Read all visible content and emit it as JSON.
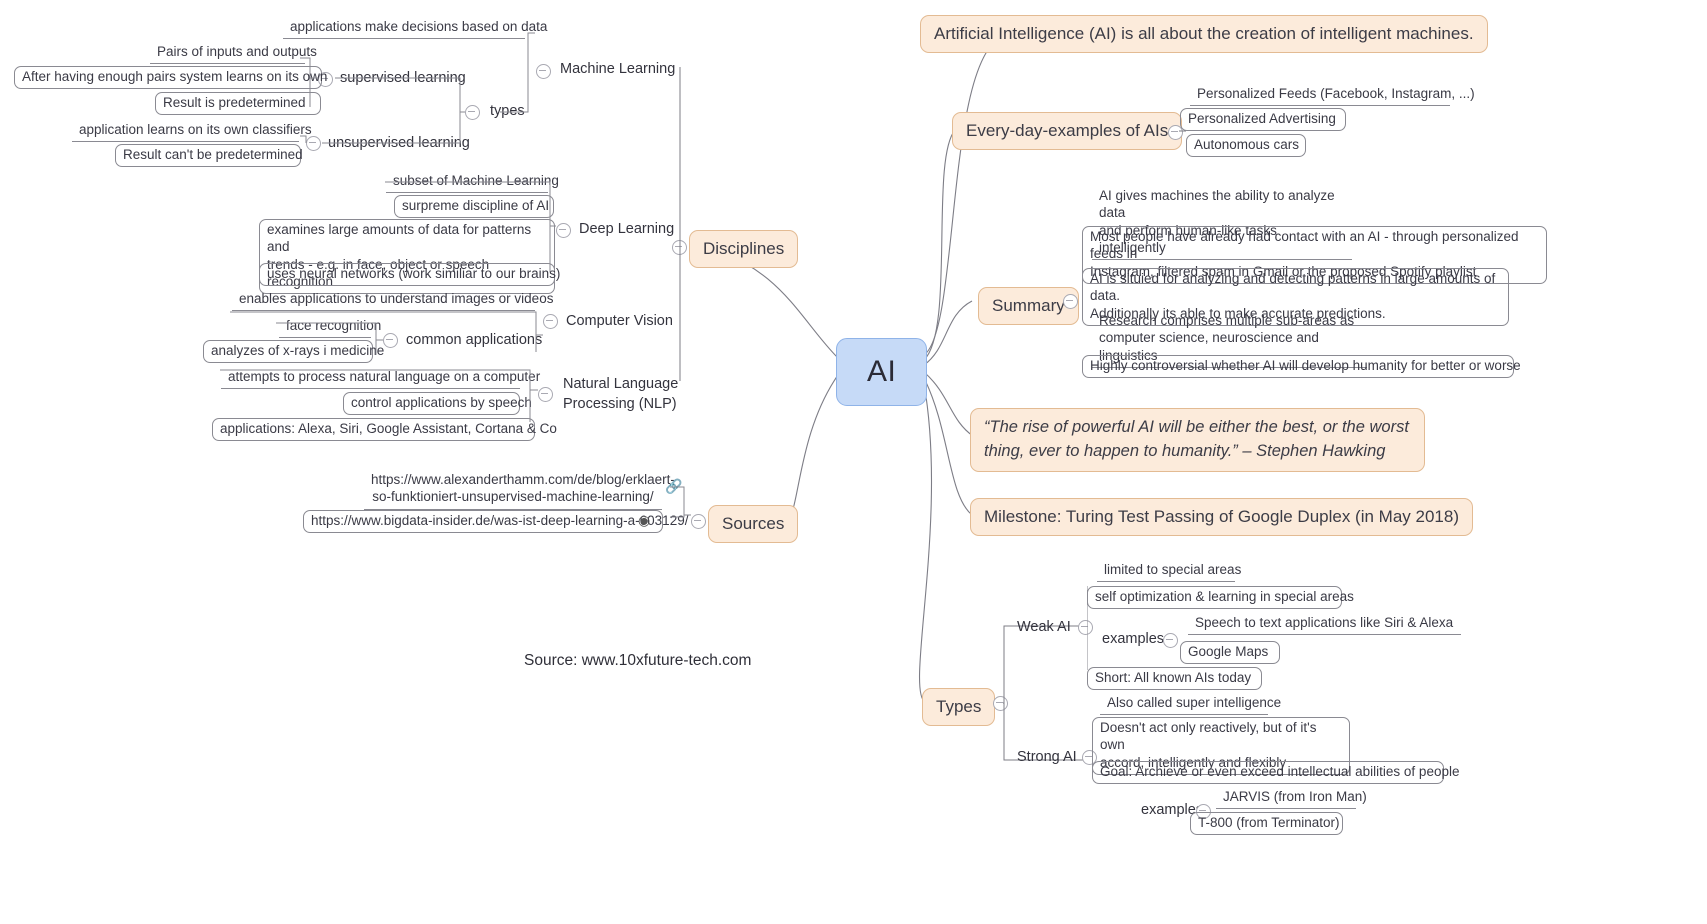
{
  "root": {
    "label": "AI"
  },
  "footer": {
    "source": "Source: www.10xfuture-tech.com"
  },
  "right": {
    "definition": "Artificial Intelligence (AI) is all about the creation of intelligent machines.",
    "examples": {
      "label": "Every-day-examples of AIs",
      "items": [
        "Personalized Feeds (Facebook, Instagram, ...)",
        "Personalized Advertising",
        "Autonomous cars"
      ]
    },
    "summary": {
      "label": "Summary",
      "items": [
        "AI gives machines the ability to analyze data\nand perform human-like tasks intelligently",
        "Most people have already had contact with an AI - through personalized feeds in\nInstagram, filtered spam in Gmail or the proposed Spotify playlist",
        "AI is situied for analyzing and detecting patterns in large amounts of data.\nAdditionally its able to make accurate predictions.",
        "Research comprises multiple sub-areas as\ncomputer science, neuroscience and linguistics",
        "Highly controversial whether AI will develop humanity for better or worse"
      ]
    },
    "quote": "“The rise of powerful AI will be either the best, or the worst\nthing, ever to happen to humanity.” – Stephen Hawking",
    "milestone": "Milestone: Turing Test Passing of Google Duplex (in May 2018)",
    "types": {
      "label": "Types",
      "weak": {
        "label": "Weak AI",
        "items": [
          "limited to special areas",
          "self optimization & learning in special areas",
          "Short: All known AIs today"
        ],
        "examples_label": "examples",
        "examples": [
          "Speech to text applications like Siri & Alexa",
          "Google Maps"
        ]
      },
      "strong": {
        "label": "Strong AI",
        "items": [
          "Also called super intelligence",
          "Doesn't act only reactively, but of it's own\naccord, intelligently and flexibly",
          "Goal: Archieve or even exceed intellectual abilities of people"
        ],
        "examples_label": "examples",
        "examples": [
          "JARVIS (from Iron Man)",
          "T-800 (from Terminator)"
        ]
      }
    }
  },
  "left": {
    "disciplines": {
      "label": "Disciplines",
      "machine_learning": {
        "label": "Machine Learning",
        "items": [
          "applications make decisions based on data"
        ],
        "types_label": "types",
        "supervised": {
          "label": "supervised learning",
          "items": [
            "Pairs of inputs and outputs",
            "After having enough pairs system learns on its own",
            "Result is predetermined"
          ]
        },
        "unsupervised": {
          "label": "unsupervised learning",
          "items": [
            "application learns on its own classifiers",
            "Result can't be predetermined"
          ]
        }
      },
      "deep_learning": {
        "label": "Deep Learning",
        "items": [
          "subset of Machine Learning",
          "surpreme discipline of AI",
          "examines large amounts of data for patterns and\ntrends - e.g. in face, object or speech recognition",
          "uses neural networks (work similiar to our brains)"
        ]
      },
      "computer_vision": {
        "label": "Computer Vision",
        "items": [
          "enables applications to understand images or videos"
        ],
        "common_label": "common applications",
        "common": [
          "face recognition",
          "analyzes of x-rays i medicine"
        ]
      },
      "nlp": {
        "label": "Natural Language\nProcessing (NLP)",
        "items": [
          "attempts to process natural language on a computer",
          "control applications by speech",
          "applications: Alexa, Siri, Google Assistant, Cortana & Co"
        ]
      }
    },
    "sources": {
      "label": "Sources",
      "items": [
        "https://www.alexanderthamm.com/de/blog/erklaert-\nso-funktioniert-unsupervised-machine-learning/",
        "https://www.bigdata-insider.de/was-ist-deep-learning-a-603129/"
      ],
      "icons": [
        "link-icon",
        "target-icon"
      ]
    }
  }
}
